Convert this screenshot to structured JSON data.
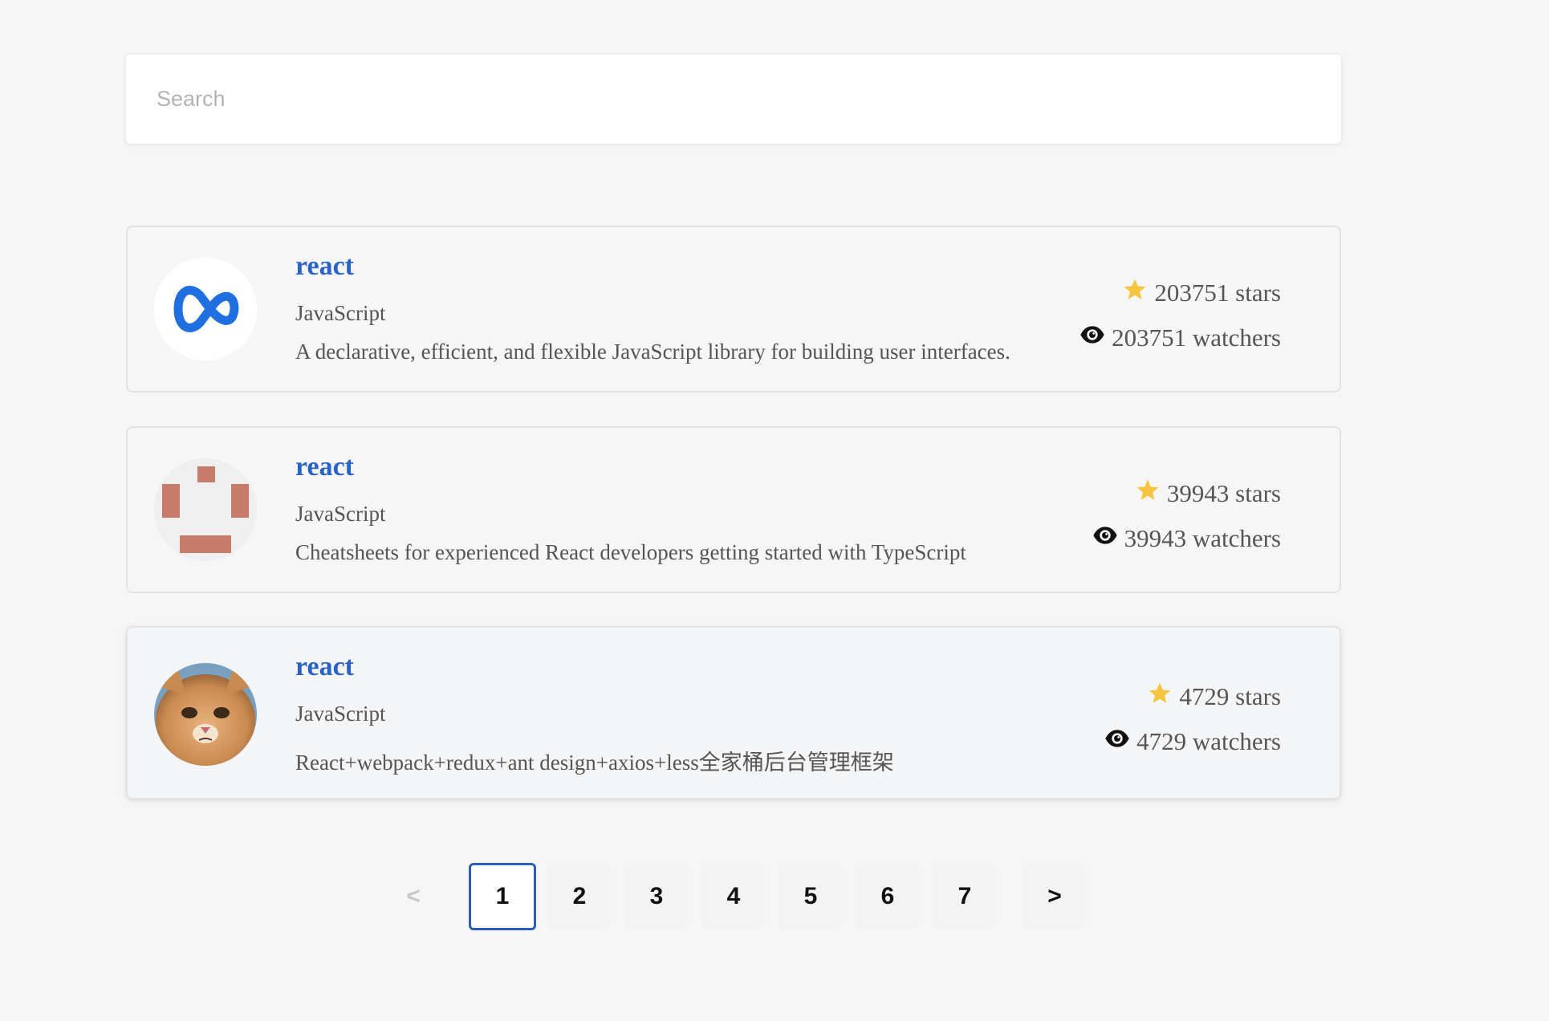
{
  "search": {
    "placeholder": "Search",
    "value": ""
  },
  "repos": [
    {
      "name": "react",
      "language": "JavaScript",
      "description": "A declarative, efficient, and flexible JavaScript library for building user interfaces.",
      "stars": "203751 stars",
      "watchers": "203751 watchers",
      "avatar": "meta-logo"
    },
    {
      "name": "react",
      "language": "JavaScript",
      "description": "Cheatsheets for experienced React developers getting started with TypeScript",
      "stars": "39943 stars",
      "watchers": "39943 watchers",
      "avatar": "pixel-identicon"
    },
    {
      "name": "react",
      "language": "JavaScript",
      "description": "React+webpack+redux+ant design+axios+less全家桶后台管理框架",
      "stars": "4729 stars",
      "watchers": "4729 watchers",
      "avatar": "cat-photo"
    }
  ],
  "pagination": {
    "prev_label": "<",
    "next_label": ">",
    "pages": [
      "1",
      "2",
      "3",
      "4",
      "5",
      "6",
      "7"
    ],
    "current": "1"
  },
  "colors": {
    "link": "#2a63c6",
    "star": "#f5c542",
    "active_page_border": "#2a5fb8"
  }
}
